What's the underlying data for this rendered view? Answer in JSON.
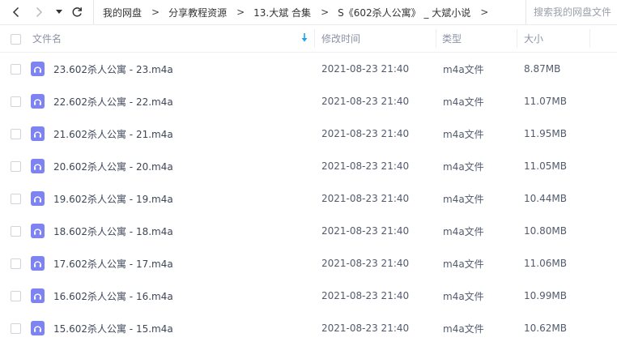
{
  "toolbar": {
    "back_icon": "chevron-left-icon",
    "forward_icon": "chevron-right-icon",
    "history_icon": "caret-down-icon",
    "refresh_icon": "refresh-icon"
  },
  "breadcrumb": {
    "items": [
      "我的网盘",
      "分享教程资源",
      "13.大斌 合集",
      "S《602杀人公寓》 _ 大斌小说"
    ],
    "separator": ">"
  },
  "search": {
    "placeholder": "搜索我的网盘文件"
  },
  "table": {
    "columns": {
      "name": "文件名",
      "time": "修改时间",
      "type": "类型",
      "size": "大小"
    },
    "sort": {
      "column": "name",
      "icon": "sort-down-arrow-icon",
      "color": "#1ea4e9"
    },
    "rows": [
      {
        "name": "23.602杀人公寓 - 23.m4a",
        "time": "2021-08-23 21:40",
        "type": "m4a文件",
        "size": "8.87MB"
      },
      {
        "name": "22.602杀人公寓 - 22.m4a",
        "time": "2021-08-23 21:40",
        "type": "m4a文件",
        "size": "11.07MB"
      },
      {
        "name": "21.602杀人公寓 - 21.m4a",
        "time": "2021-08-23 21:40",
        "type": "m4a文件",
        "size": "11.95MB"
      },
      {
        "name": "20.602杀人公寓 - 20.m4a",
        "time": "2021-08-23 21:40",
        "type": "m4a文件",
        "size": "11.05MB"
      },
      {
        "name": "19.602杀人公寓 - 19.m4a",
        "time": "2021-08-23 21:40",
        "type": "m4a文件",
        "size": "10.44MB"
      },
      {
        "name": "18.602杀人公寓 - 18.m4a",
        "time": "2021-08-23 21:40",
        "type": "m4a文件",
        "size": "10.80MB"
      },
      {
        "name": "17.602杀人公寓 - 17.m4a",
        "time": "2021-08-23 21:40",
        "type": "m4a文件",
        "size": "11.06MB"
      },
      {
        "name": "16.602杀人公寓 - 16.m4a",
        "time": "2021-08-23 21:40",
        "type": "m4a文件",
        "size": "10.99MB"
      },
      {
        "name": "15.602杀人公寓 - 15.m4a",
        "time": "2021-08-23 21:40",
        "type": "m4a文件",
        "size": "10.62MB"
      }
    ]
  },
  "colors": {
    "audio_icon": "#7d83f0",
    "sort_accent": "#1ea4e9"
  }
}
